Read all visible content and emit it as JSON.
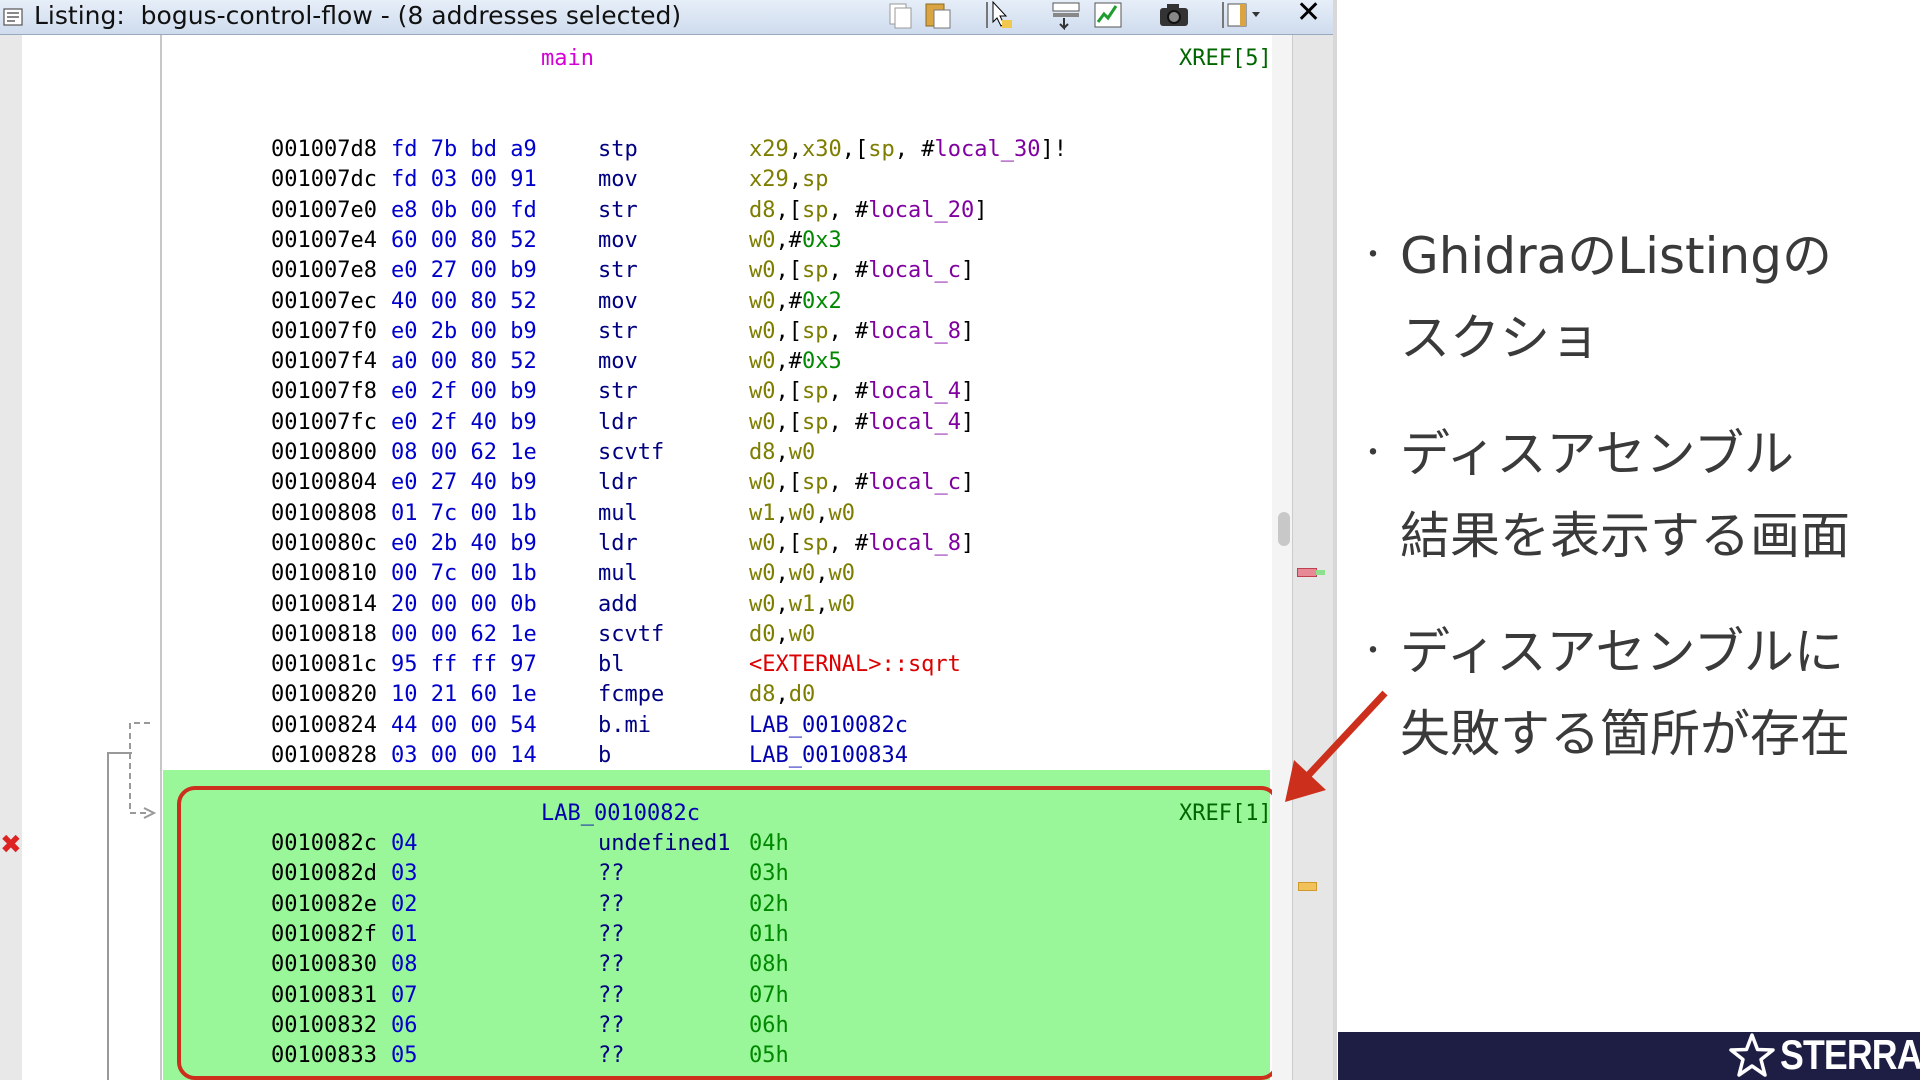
{
  "window": {
    "title": "Listing:  bogus-control-flow - (8 addresses selected)",
    "close_glyph": "✕"
  },
  "listing": {
    "function_label": "main",
    "function_xref": "XREF[5]",
    "rows": [
      {
        "addr": "001007d8",
        "bytes": "fd 7b bd a9",
        "mnemonic": "stp",
        "operand": [
          [
            "x29",
            "reg"
          ],
          [
            ",",
            "pun"
          ],
          [
            "x30",
            "reg"
          ],
          [
            ",[",
            "pun"
          ],
          [
            "sp",
            "reg"
          ],
          [
            ", #",
            "pun"
          ],
          [
            "local_30",
            "lv"
          ],
          [
            "]!",
            "pun"
          ]
        ]
      },
      {
        "addr": "001007dc",
        "bytes": "fd 03 00 91",
        "mnemonic": "mov",
        "operand": [
          [
            "x29",
            "reg"
          ],
          [
            ",",
            "pun"
          ],
          [
            "sp",
            "reg"
          ]
        ]
      },
      {
        "addr": "001007e0",
        "bytes": "e8 0b 00 fd",
        "mnemonic": "str",
        "operand": [
          [
            "d8",
            "reg"
          ],
          [
            ",[",
            "pun"
          ],
          [
            "sp",
            "reg"
          ],
          [
            ", #",
            "pun"
          ],
          [
            "local_20",
            "lv"
          ],
          [
            "]",
            "pun"
          ]
        ]
      },
      {
        "addr": "001007e4",
        "bytes": "60 00 80 52",
        "mnemonic": "mov",
        "operand": [
          [
            "w0",
            "reg"
          ],
          [
            ",#",
            "pun"
          ],
          [
            "0x3",
            "num"
          ]
        ]
      },
      {
        "addr": "001007e8",
        "bytes": "e0 27 00 b9",
        "mnemonic": "str",
        "operand": [
          [
            "w0",
            "reg"
          ],
          [
            ",[",
            "pun"
          ],
          [
            "sp",
            "reg"
          ],
          [
            ", #",
            "pun"
          ],
          [
            "local_c",
            "lv"
          ],
          [
            "]",
            "pun"
          ]
        ]
      },
      {
        "addr": "001007ec",
        "bytes": "40 00 80 52",
        "mnemonic": "mov",
        "operand": [
          [
            "w0",
            "reg"
          ],
          [
            ",#",
            "pun"
          ],
          [
            "0x2",
            "num"
          ]
        ]
      },
      {
        "addr": "001007f0",
        "bytes": "e0 2b 00 b9",
        "mnemonic": "str",
        "operand": [
          [
            "w0",
            "reg"
          ],
          [
            ",[",
            "pun"
          ],
          [
            "sp",
            "reg"
          ],
          [
            ", #",
            "pun"
          ],
          [
            "local_8",
            "lv"
          ],
          [
            "]",
            "pun"
          ]
        ]
      },
      {
        "addr": "001007f4",
        "bytes": "a0 00 80 52",
        "mnemonic": "mov",
        "operand": [
          [
            "w0",
            "reg"
          ],
          [
            ",#",
            "pun"
          ],
          [
            "0x5",
            "num"
          ]
        ]
      },
      {
        "addr": "001007f8",
        "bytes": "e0 2f 00 b9",
        "mnemonic": "str",
        "operand": [
          [
            "w0",
            "reg"
          ],
          [
            ",[",
            "pun"
          ],
          [
            "sp",
            "reg"
          ],
          [
            ", #",
            "pun"
          ],
          [
            "local_4",
            "lv"
          ],
          [
            "]",
            "pun"
          ]
        ]
      },
      {
        "addr": "001007fc",
        "bytes": "e0 2f 40 b9",
        "mnemonic": "ldr",
        "operand": [
          [
            "w0",
            "reg"
          ],
          [
            ",[",
            "pun"
          ],
          [
            "sp",
            "reg"
          ],
          [
            ", #",
            "pun"
          ],
          [
            "local_4",
            "lv"
          ],
          [
            "]",
            "pun"
          ]
        ]
      },
      {
        "addr": "00100800",
        "bytes": "08 00 62 1e",
        "mnemonic": "scvtf",
        "operand": [
          [
            "d8",
            "reg"
          ],
          [
            ",",
            "pun"
          ],
          [
            "w0",
            "reg"
          ]
        ]
      },
      {
        "addr": "00100804",
        "bytes": "e0 27 40 b9",
        "mnemonic": "ldr",
        "operand": [
          [
            "w0",
            "reg"
          ],
          [
            ",[",
            "pun"
          ],
          [
            "sp",
            "reg"
          ],
          [
            ", #",
            "pun"
          ],
          [
            "local_c",
            "lv"
          ],
          [
            "]",
            "pun"
          ]
        ]
      },
      {
        "addr": "00100808",
        "bytes": "01 7c 00 1b",
        "mnemonic": "mul",
        "operand": [
          [
            "w1",
            "reg"
          ],
          [
            ",",
            "pun"
          ],
          [
            "w0",
            "reg"
          ],
          [
            ",",
            "pun"
          ],
          [
            "w0",
            "reg"
          ]
        ]
      },
      {
        "addr": "0010080c",
        "bytes": "e0 2b 40 b9",
        "mnemonic": "ldr",
        "operand": [
          [
            "w0",
            "reg"
          ],
          [
            ",[",
            "pun"
          ],
          [
            "sp",
            "reg"
          ],
          [
            ", #",
            "pun"
          ],
          [
            "local_8",
            "lv"
          ],
          [
            "]",
            "pun"
          ]
        ]
      },
      {
        "addr": "00100810",
        "bytes": "00 7c 00 1b",
        "mnemonic": "mul",
        "operand": [
          [
            "w0",
            "reg"
          ],
          [
            ",",
            "pun"
          ],
          [
            "w0",
            "reg"
          ],
          [
            ",",
            "pun"
          ],
          [
            "w0",
            "reg"
          ]
        ]
      },
      {
        "addr": "00100814",
        "bytes": "20 00 00 0b",
        "mnemonic": "add",
        "operand": [
          [
            "w0",
            "reg"
          ],
          [
            ",",
            "pun"
          ],
          [
            "w1",
            "reg"
          ],
          [
            ",",
            "pun"
          ],
          [
            "w0",
            "reg"
          ]
        ]
      },
      {
        "addr": "00100818",
        "bytes": "00 00 62 1e",
        "mnemonic": "scvtf",
        "operand": [
          [
            "d0",
            "reg"
          ],
          [
            ",",
            "pun"
          ],
          [
            "w0",
            "reg"
          ]
        ]
      },
      {
        "addr": "0010081c",
        "bytes": "95 ff ff 97",
        "mnemonic": "bl",
        "operand": [
          [
            "<EXTERNAL>::sqrt",
            "ext"
          ]
        ]
      },
      {
        "addr": "00100820",
        "bytes": "10 21 60 1e",
        "mnemonic": "fcmpe",
        "operand": [
          [
            "d8",
            "reg"
          ],
          [
            ",",
            "pun"
          ],
          [
            "d0",
            "reg"
          ]
        ]
      },
      {
        "addr": "00100824",
        "bytes": "44 00 00 54",
        "mnemonic": "b.mi",
        "operand": [
          [
            "LAB_0010082c",
            "lab"
          ]
        ]
      },
      {
        "addr": "00100828",
        "bytes": "03 00 00 14",
        "mnemonic": "b",
        "operand": [
          [
            "LAB_00100834",
            "lab"
          ]
        ]
      }
    ],
    "label_block": {
      "label": "LAB_0010082c",
      "xref": "XREF[1]",
      "rows": [
        {
          "addr": "0010082c",
          "bytes": "04",
          "mnemonic": "undefined1",
          "operand": [
            [
              "04h",
              "num"
            ]
          ]
        },
        {
          "addr": "0010082d",
          "bytes": "03",
          "mnemonic": "??",
          "operand": [
            [
              "03h",
              "num"
            ]
          ]
        },
        {
          "addr": "0010082e",
          "bytes": "02",
          "mnemonic": "??",
          "operand": [
            [
              "02h",
              "num"
            ]
          ]
        },
        {
          "addr": "0010082f",
          "bytes": "01",
          "mnemonic": "??",
          "operand": [
            [
              "01h",
              "num"
            ]
          ]
        },
        {
          "addr": "00100830",
          "bytes": "08",
          "mnemonic": "??",
          "operand": [
            [
              "08h",
              "num"
            ]
          ]
        },
        {
          "addr": "00100831",
          "bytes": "07",
          "mnemonic": "??",
          "operand": [
            [
              "07h",
              "num"
            ]
          ]
        },
        {
          "addr": "00100832",
          "bytes": "06",
          "mnemonic": "??",
          "operand": [
            [
              "06h",
              "num"
            ]
          ]
        },
        {
          "addr": "00100833",
          "bytes": "05",
          "mnemonic": "??",
          "operand": [
            [
              "05h",
              "num"
            ]
          ]
        }
      ]
    }
  },
  "slide": {
    "bullets": [
      {
        "dot": "・",
        "line1": "GhidraのListingの",
        "line2": "スクショ"
      },
      {
        "dot": "・",
        "line1": "ディスアセンブル",
        "line2": "結果を表示する画面"
      },
      {
        "dot": "・",
        "line1": "ディスアセンブルに",
        "line2": "失敗する箇所が存在"
      }
    ],
    "logo_text": "STERRA",
    "colors": {
      "highlight_green": "#99f799",
      "box_red": "#cc2f1c",
      "footer_navy": "#1e1e45"
    }
  }
}
